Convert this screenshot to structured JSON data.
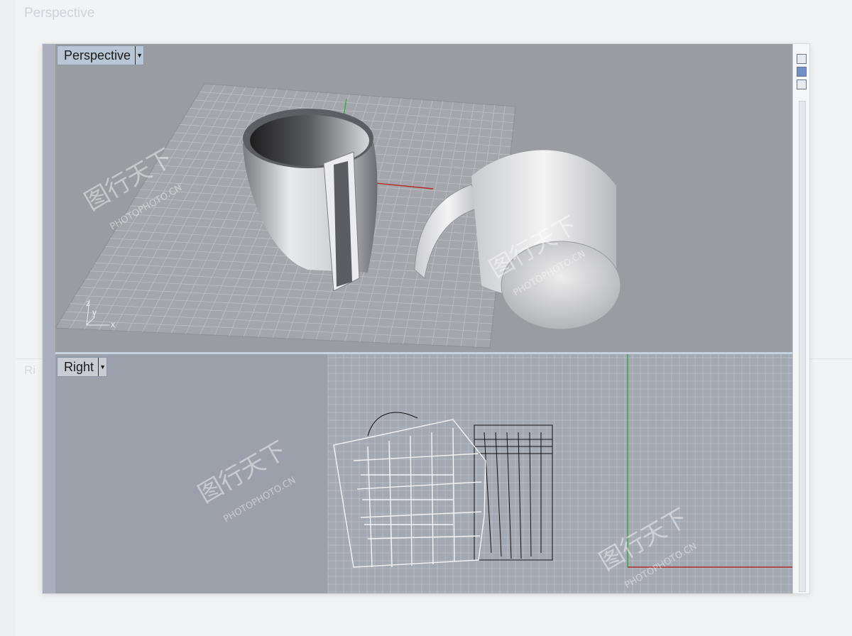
{
  "background": {
    "ghost_title": "Perspective",
    "ghost_right": "Ri"
  },
  "viewports": {
    "perspective": {
      "label": "Perspective"
    },
    "right": {
      "label": "Right"
    }
  },
  "axis_labels": {
    "z": "z",
    "y": "y",
    "x": "x"
  },
  "watermark": {
    "chinese": "图行天下",
    "latin": "PHOTOPHOTO.CN"
  },
  "colors": {
    "grid": "#c9cbcf",
    "x_axis": "#b22b2b",
    "y_axis": "#2fa84a",
    "label_bg": "#b9c6d6"
  }
}
